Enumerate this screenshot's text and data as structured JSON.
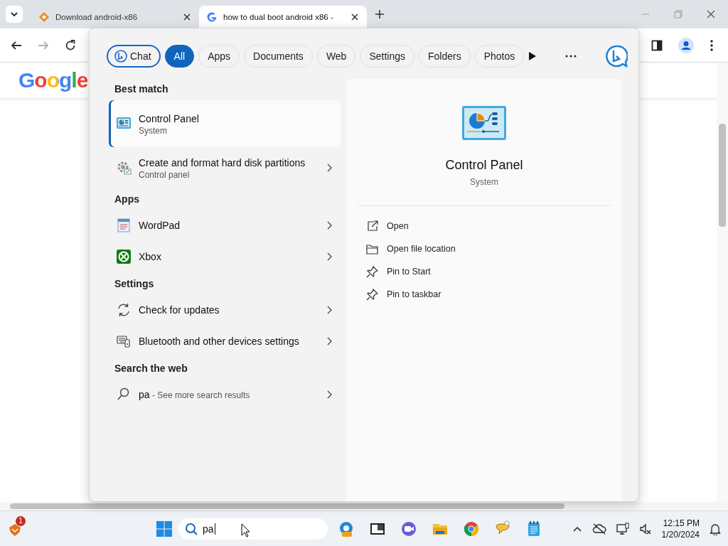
{
  "browser": {
    "tabs": [
      {
        "title": "Download android-x86",
        "selected": false
      },
      {
        "title": "how to dual boot android x86 -",
        "selected": true
      }
    ],
    "forward_disabled": true,
    "page": {
      "logo": "Google"
    }
  },
  "search_flyout": {
    "filters": [
      {
        "label": "Chat",
        "kind": "chat",
        "selected": false
      },
      {
        "label": "All",
        "kind": "chip",
        "selected": true
      },
      {
        "label": "Apps",
        "kind": "chip",
        "selected": false
      },
      {
        "label": "Documents",
        "kind": "chip",
        "selected": false
      },
      {
        "label": "Web",
        "kind": "chip",
        "selected": false
      },
      {
        "label": "Settings",
        "kind": "chip",
        "selected": false
      },
      {
        "label": "Folders",
        "kind": "chip",
        "selected": false
      },
      {
        "label": "Photos",
        "kind": "chip",
        "selected": false
      }
    ],
    "sections": [
      {
        "heading": "Best match",
        "items": [
          {
            "title": "Control Panel",
            "subtitle": "System",
            "selected": true
          },
          {
            "title": "Create and format hard disk partitions",
            "subtitle": "Control panel",
            "selected": false
          }
        ]
      },
      {
        "heading": "Apps",
        "items": [
          {
            "title": "WordPad",
            "selected": false
          },
          {
            "title": "Xbox",
            "selected": false
          }
        ]
      },
      {
        "heading": "Settings",
        "items": [
          {
            "title": "Check for updates",
            "selected": false
          },
          {
            "title": "Bluetooth and other devices settings",
            "selected": false
          }
        ]
      },
      {
        "heading": "Search the web",
        "items": [
          {
            "title": "pa",
            "hint": "- See more search results",
            "selected": false
          }
        ]
      }
    ],
    "preview": {
      "title": "Control Panel",
      "subtitle": "System",
      "actions": [
        {
          "label": "Open"
        },
        {
          "label": "Open file location"
        },
        {
          "label": "Pin to Start"
        },
        {
          "label": "Pin to taskbar"
        }
      ]
    }
  },
  "taskbar": {
    "widget_badge": "1",
    "search_value": "pa",
    "time": "12:15 PM",
    "date": "1/20/2024"
  }
}
